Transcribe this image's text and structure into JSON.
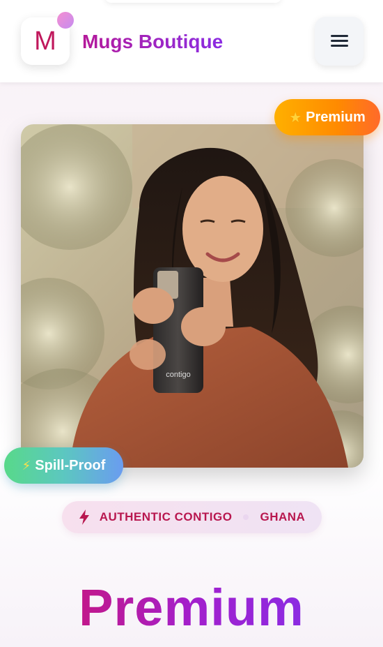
{
  "header": {
    "logo_letter": "M",
    "brand_name": "Mugs Boutique",
    "menu_icon": "hamburger-icon"
  },
  "hero": {
    "image_description_icon": "product-photo",
    "premium_badge": {
      "icon": "star-icon",
      "label": "Premium"
    },
    "spill_badge": {
      "icon": "bolt-icon",
      "label": "Spill-Proof"
    }
  },
  "origin": {
    "icon": "bolt-icon",
    "brand": "AUTHENTIC CONTIGO",
    "country": "GHANA"
  },
  "heading": "Premium",
  "colors": {
    "brand_gradient_start": "#b5199a",
    "brand_gradient_end": "#8a2be2",
    "premium_badge": "#ff9a00",
    "spill_badge_start": "#58d98a",
    "spill_badge_end": "#6a9cf0",
    "origin_text": "#b8174f"
  }
}
